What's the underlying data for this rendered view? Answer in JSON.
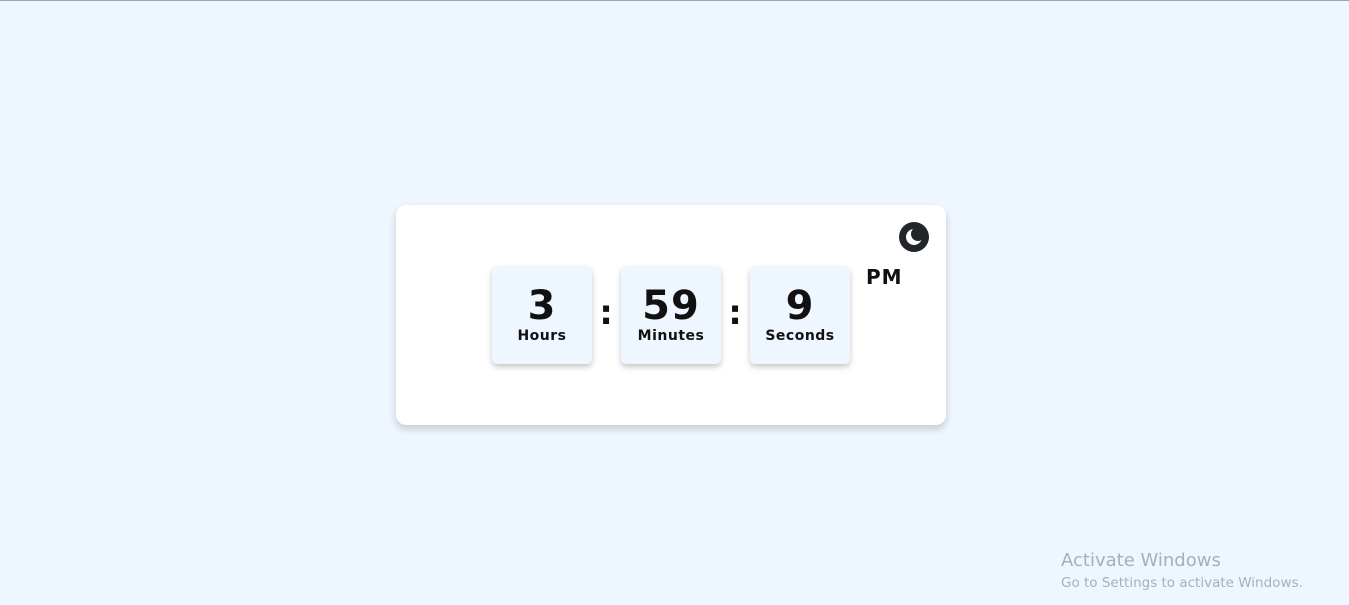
{
  "clock": {
    "hours": "3",
    "hours_label": "Hours",
    "minutes": "59",
    "minutes_label": "Minutes",
    "seconds": "9",
    "seconds_label": "Seconds",
    "separator": ":",
    "period": "PM"
  },
  "theme_toggle": {
    "icon": "moon-icon"
  },
  "watermark": {
    "title": "Activate Windows",
    "subtitle": "Go to Settings to activate Windows."
  },
  "colors": {
    "page_background": "#eef6ff",
    "card_background": "#ffffff",
    "tile_background": "#eef6ff",
    "toggle_background": "#22262b",
    "text": "#111111",
    "watermark_text": "#a9afb6"
  }
}
